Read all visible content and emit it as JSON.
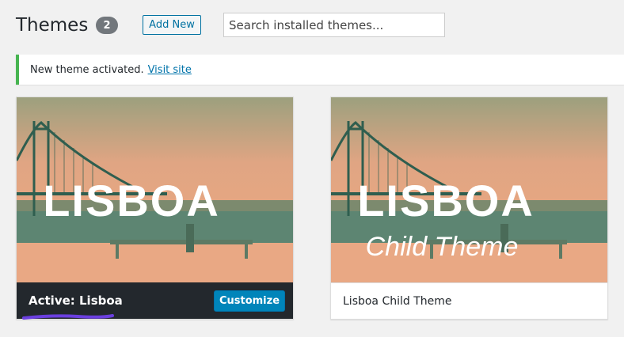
{
  "header": {
    "title": "Themes",
    "count": "2",
    "add_new": "Add New",
    "search_placeholder": "Search installed themes..."
  },
  "notice": {
    "message": "New theme activated.",
    "link": "Visit site"
  },
  "themes": [
    {
      "screenshot_title": "LISBOA",
      "screenshot_subtitle": "",
      "name_prefix": "Active:",
      "name": "Lisboa",
      "action": "Customize"
    },
    {
      "screenshot_title": "LISBOA",
      "screenshot_subtitle": "Child Theme",
      "name": "Lisboa Child Theme"
    }
  ],
  "colors": {
    "accent": "#0085ba",
    "notice_success": "#46b450",
    "highlight_mark": "#6b3fe0"
  }
}
